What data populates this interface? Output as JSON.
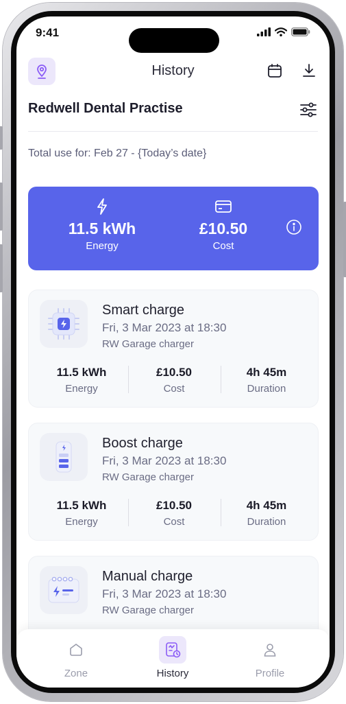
{
  "status": {
    "time": "9:41"
  },
  "header": {
    "title": "History"
  },
  "site": {
    "name": "Redwell Dental Practise"
  },
  "total_use": "Total use for: Feb 27 - {Today’s date}",
  "summary": {
    "energy_value": "11.5 kWh",
    "energy_label": "Energy",
    "cost_value": "£10.50",
    "cost_label": "Cost",
    "bg_color": "#5864ea"
  },
  "sessions": [
    {
      "title": "Smart charge",
      "date": "Fri, 3 Mar 2023 at 18:30",
      "charger": "RW Garage charger",
      "energy": "11.5 kWh",
      "energy_label": "Energy",
      "cost": "£10.50",
      "cost_label": "Cost",
      "duration": "4h 45m",
      "duration_label": "Duration",
      "icon": "smart-charge-chip-icon"
    },
    {
      "title": "Boost charge",
      "date": "Fri, 3 Mar 2023 at 18:30",
      "charger": "RW Garage charger",
      "energy": "11.5 kWh",
      "energy_label": "Energy",
      "cost": "£10.50",
      "cost_label": "Cost",
      "duration": "4h 45m",
      "duration_label": "Duration",
      "icon": "boost-charge-battery-icon"
    },
    {
      "title": "Manual charge",
      "date": "Fri, 3 Mar 2023 at 18:30",
      "charger": "RW Garage charger",
      "icon": "manual-charge-calendar-icon"
    }
  ],
  "tabs": [
    {
      "label": "Zone",
      "icon": "home-icon",
      "active": false
    },
    {
      "label": "History",
      "icon": "history-icon",
      "active": true
    },
    {
      "label": "Profile",
      "icon": "profile-icon",
      "active": false
    }
  ],
  "colors": {
    "accent": "#5864ea",
    "accent_soft": "#ece7fb",
    "icon_purple": "#8b5cf6"
  }
}
